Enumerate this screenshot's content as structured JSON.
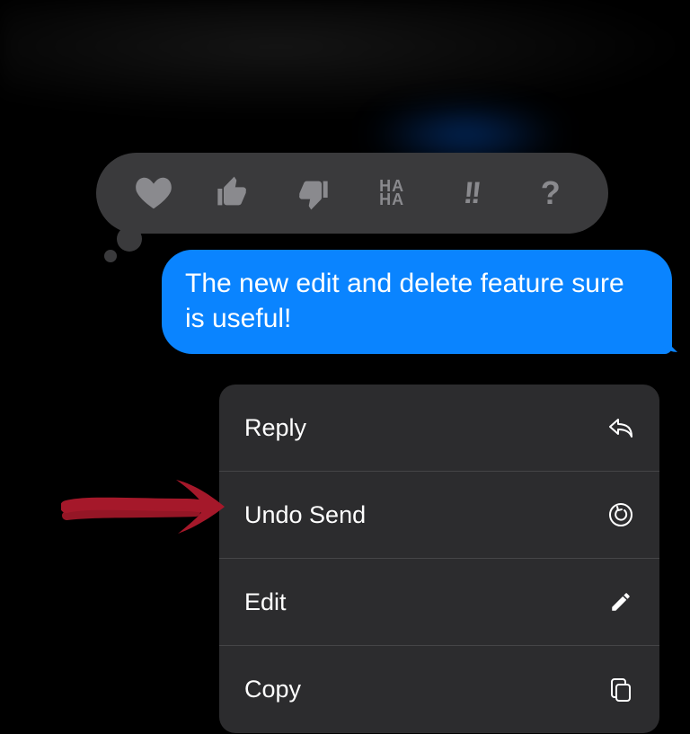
{
  "tapback": {
    "reactions": [
      {
        "name": "heart"
      },
      {
        "name": "thumbs-up"
      },
      {
        "name": "thumbs-down"
      },
      {
        "name": "haha",
        "text_top": "HA",
        "text_bottom": "HA"
      },
      {
        "name": "exclaim",
        "text": "!!"
      },
      {
        "name": "question",
        "text": "?"
      }
    ]
  },
  "message": {
    "text": "The new edit and delete feature sure is useful!"
  },
  "menu": {
    "items": [
      {
        "label": "Reply",
        "icon": "reply-icon"
      },
      {
        "label": "Undo Send",
        "icon": "undo-icon"
      },
      {
        "label": "Edit",
        "icon": "pencil-icon"
      },
      {
        "label": "Copy",
        "icon": "copy-icon"
      }
    ]
  },
  "annotation": {
    "color": "#a5182a"
  }
}
